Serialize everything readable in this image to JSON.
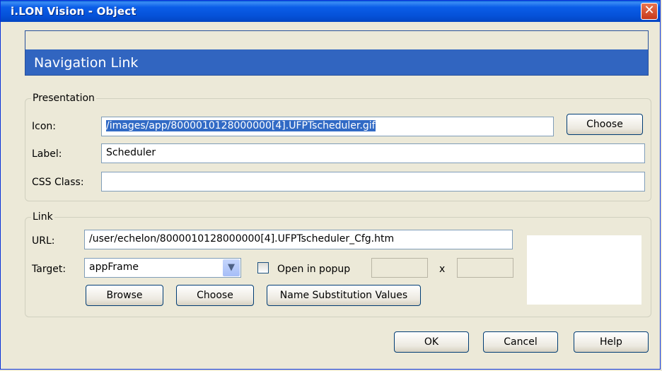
{
  "window": {
    "title": "i.LON Vision - Object"
  },
  "header": {
    "title": "Navigation Link"
  },
  "presentation": {
    "legend": "Presentation",
    "icon_label": "Icon:",
    "icon_value": "/images/app/8000010128000000[4].UFPTscheduler.gif",
    "choose_label": "Choose",
    "label_label": "Label:",
    "label_value": "Scheduler",
    "css_label": "CSS Class:",
    "css_value": ""
  },
  "link": {
    "legend": "Link",
    "url_label": "URL:",
    "url_value": "/user/echelon/8000010128000000[4].UFPTscheduler_Cfg.htm",
    "target_label": "Target:",
    "target_value": "appFrame",
    "popup_label": "Open in popup",
    "popup_checked": false,
    "x_label": "x",
    "browse_label": "Browse",
    "choose_label": "Choose",
    "substitution_label": "Name Substitution Values"
  },
  "footer": {
    "ok": "OK",
    "cancel": "Cancel",
    "help": "Help"
  }
}
